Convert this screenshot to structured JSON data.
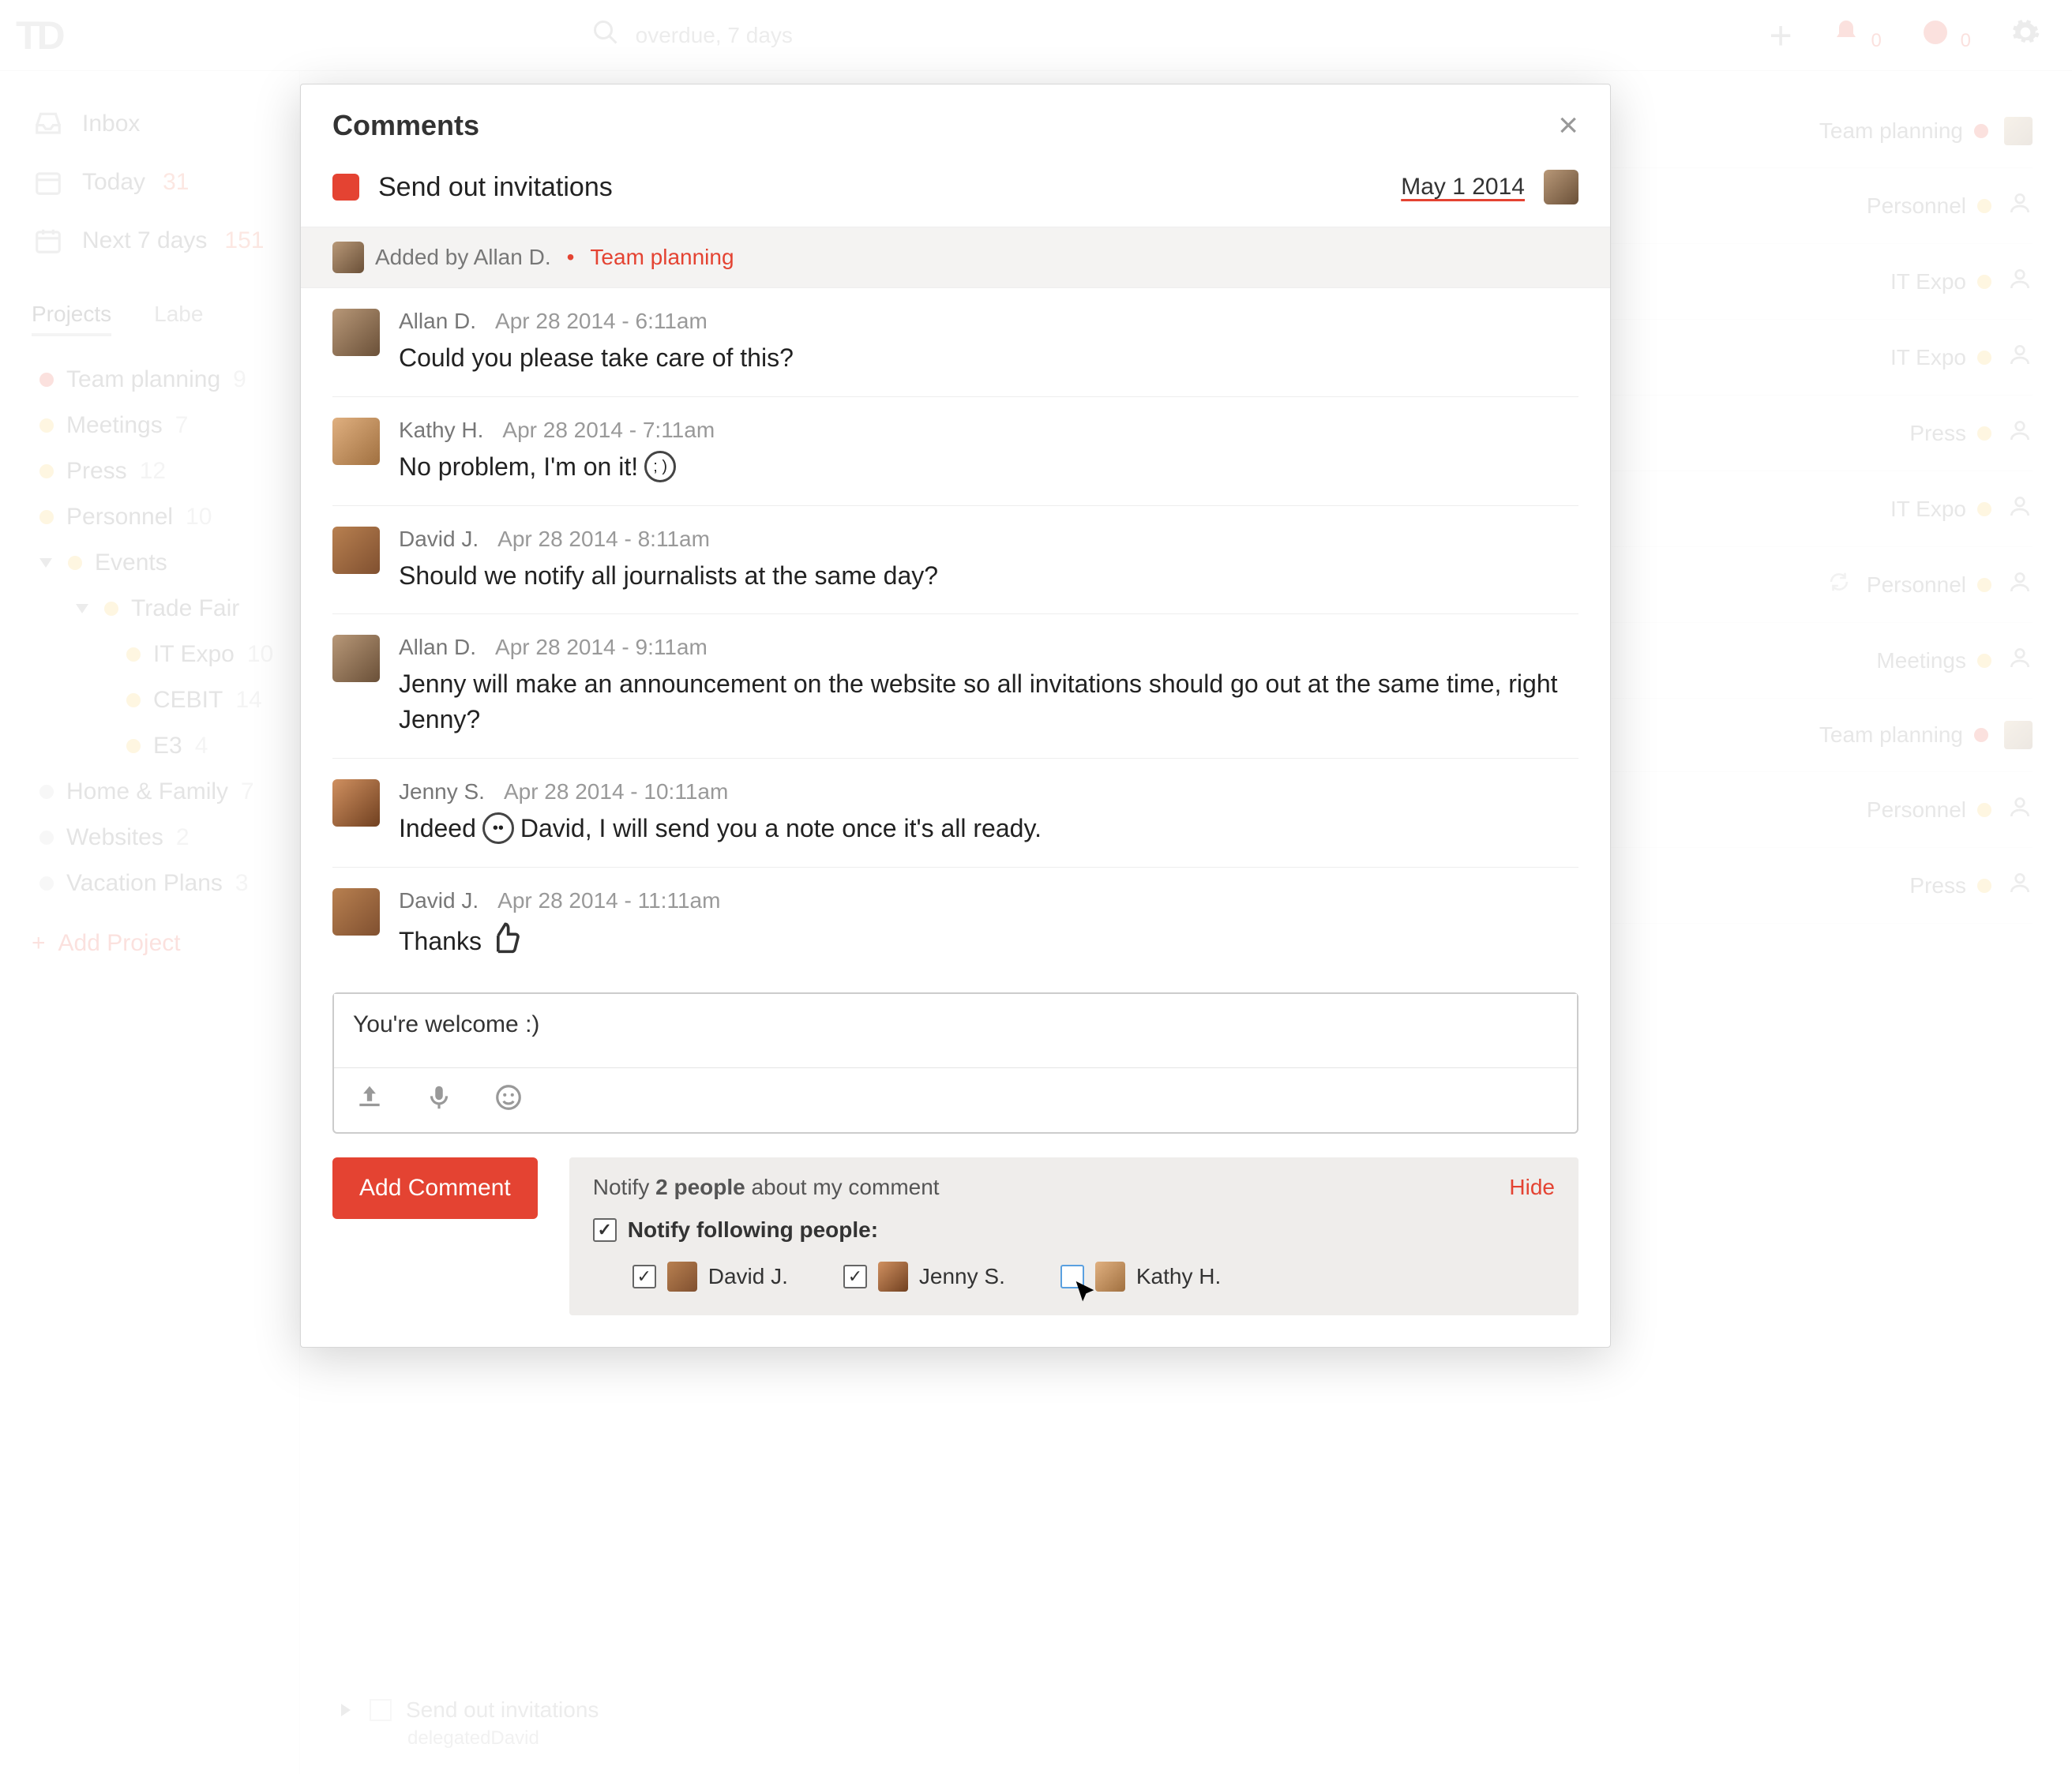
{
  "topbar": {
    "search_placeholder": "overdue, 7 days",
    "notif_count": "0",
    "karma_count": "0"
  },
  "sidebar": {
    "inbox": "Inbox",
    "today": "Today",
    "today_count": "31",
    "next7": "Next 7 days",
    "next7_count": "151",
    "tabs": {
      "projects": "Projects",
      "labels": "Labe"
    },
    "projects": [
      {
        "name": "Team planning",
        "count": "9"
      },
      {
        "name": "Meetings",
        "count": "7"
      },
      {
        "name": "Press",
        "count": "12"
      },
      {
        "name": "Personnel",
        "count": "10"
      },
      {
        "name": "Events",
        "count": ""
      },
      {
        "name": "Trade Fair",
        "count": ""
      },
      {
        "name": "IT Expo",
        "count": "10"
      },
      {
        "name": "CEBIT",
        "count": "14"
      },
      {
        "name": "E3",
        "count": "4"
      },
      {
        "name": "Home & Family",
        "count": "7"
      },
      {
        "name": "Websites",
        "count": "2"
      },
      {
        "name": "Vacation Plans",
        "count": "3"
      }
    ],
    "add_project": "Add Project"
  },
  "content_rows": [
    {
      "label": "Team planning",
      "color": "red",
      "avatar": true
    },
    {
      "label": "Personnel",
      "color": "yellow"
    },
    {
      "label": "IT Expo",
      "color": "yellow"
    },
    {
      "label": "IT Expo",
      "color": "yellow"
    },
    {
      "label": "Press",
      "color": "yellow"
    },
    {
      "label": "IT Expo",
      "color": "yellow"
    },
    {
      "label": "Personnel",
      "color": "yellow",
      "refresh": true
    },
    {
      "label": "Meetings",
      "color": "yellow"
    },
    {
      "label": "Team planning",
      "color": "red",
      "avatar": true
    },
    {
      "label": "Personnel",
      "color": "yellow"
    },
    {
      "label": "Press",
      "color": "yellow"
    }
  ],
  "bottom_task": {
    "title": "Send out invitations",
    "sub": "delegatedDavid"
  },
  "modal": {
    "title": "Comments",
    "task": "Send out invitations",
    "due": "May 1 2014",
    "added_by_prefix": "Added by ",
    "added_by": "Allan D.",
    "project": "Team planning",
    "comments": [
      {
        "author": "Allan D.",
        "time": "Apr 28 2014 - 6:11am",
        "body": "Could you please take care of this?",
        "av": "allan"
      },
      {
        "author": "Kathy H.",
        "time": "Apr 28 2014 - 7:11am",
        "body": "No problem, I'm on it!",
        "emoji": "wink",
        "av": "kathy"
      },
      {
        "author": "David J.",
        "time": "Apr 28 2014 - 8:11am",
        "body": "Should we notify all journalists at the same day?",
        "av": "david"
      },
      {
        "author": "Allan D.",
        "time": "Apr 28 2014 - 9:11am",
        "body": "Jenny will make an announcement on the website so all invitations should go out at the same time, right Jenny?",
        "av": "allan"
      },
      {
        "author": "Jenny S.",
        "time": "Apr 28 2014 - 10:11am",
        "body_pre": "Indeed",
        "body_post": "David, I will send you a note once it's all ready.",
        "emoji": "smile",
        "av": "jenny"
      },
      {
        "author": "David J.",
        "time": "Apr 28 2014 - 11:11am",
        "body": "Thanks",
        "thumb": true,
        "av": "david"
      }
    ],
    "draft": "You're welcome :)",
    "add_button": "Add Comment",
    "notify": {
      "prefix": "Notify ",
      "count": "2 people",
      "suffix": " about my comment",
      "hide": "Hide",
      "following_label": "Notify following people:",
      "people": [
        {
          "name": "David J.",
          "checked": true,
          "av": "david"
        },
        {
          "name": "Jenny S.",
          "checked": true,
          "av": "jenny"
        },
        {
          "name": "Kathy H.",
          "checked": false,
          "av": "kathy"
        }
      ]
    }
  }
}
